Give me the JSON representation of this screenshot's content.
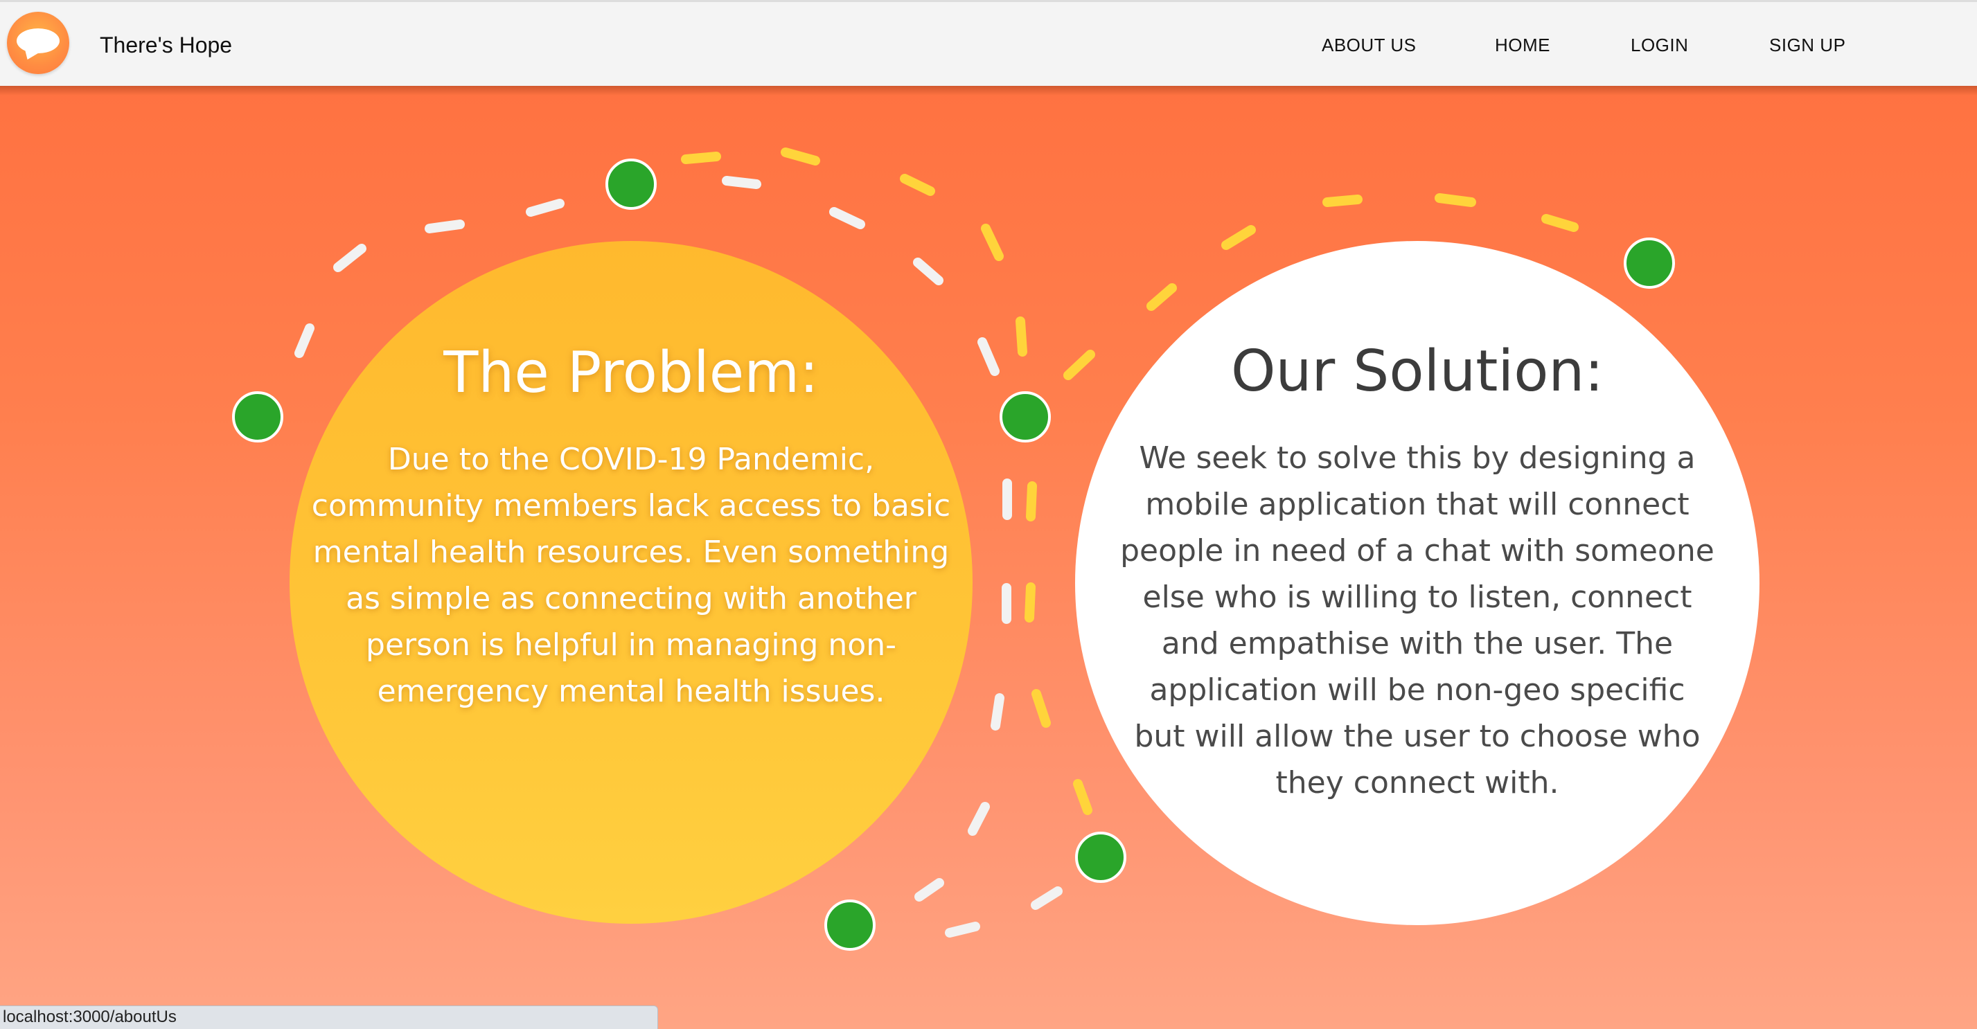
{
  "navbar": {
    "brand": "There's Hope",
    "links": [
      "ABOUT US",
      "HOME",
      "LOGIN",
      "SIGN UP"
    ]
  },
  "problem": {
    "title": "The Problem:",
    "body": "Due to the COVID-19 Pandemic, community members lack access to basic mental health resources. Even something as simple as connecting with another person is helpful in managing non-emergency mental health issues."
  },
  "solution": {
    "title": "Our Solution:",
    "body": "We seek to solve this by designing a mobile application that will connect people in need of a chat with someone else who is willing to listen, connect and empathise with the user. The application will be non-geo specific but will allow the user to choose who they connect with."
  },
  "status_bar": {
    "url": "localhost:3000/aboutUs"
  },
  "colors": {
    "accent_orange": "#ff7241",
    "problem_yellow": "#ffc537",
    "node_green": "#2aa52a",
    "dash_white": "#f2f2f2",
    "dash_yellow": "#ffd43b"
  }
}
